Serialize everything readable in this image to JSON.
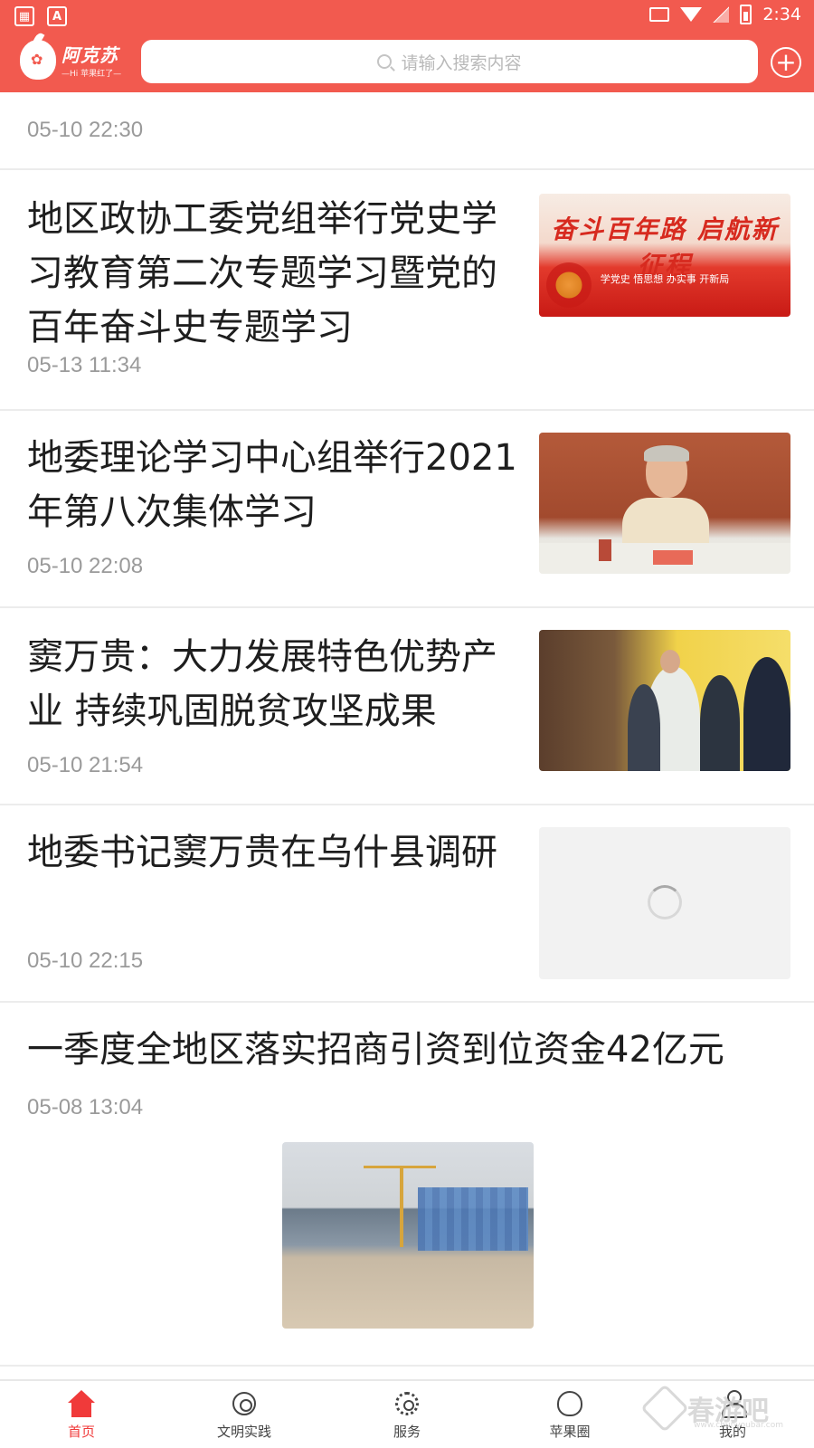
{
  "status_bar": {
    "time": "2:34",
    "notif_icons": [
      "image-icon",
      "a-icon"
    ]
  },
  "header": {
    "logo_name": "阿克苏",
    "logo_slogan": "—Hi 苹果红了—",
    "search_placeholder": "请输入搜索内容",
    "add_icon": "plus-circle-icon",
    "accent_color": "#f25a4f"
  },
  "feed": {
    "top_item_time": "05-10 22:30",
    "items": [
      {
        "title": "地区政协工委党组举行党史学习教育第二次专题学习暨党的百年奋斗史专题学习",
        "time": "05-13 11:34",
        "thumb_banner": "奋斗百年路 启航新征程",
        "thumb_sub": "学党史 悟思想 办实事 开新局"
      },
      {
        "title": "地委理论学习中心组举行2021年第八次集体学习",
        "time": "05-10 22:08"
      },
      {
        "title": "窦万贵：大力发展特色优势产业 持续巩固脱贫攻坚成果",
        "time": "05-10 21:54"
      },
      {
        "title": "地委书记窦万贵在乌什县调研",
        "time": "05-10 22:15"
      },
      {
        "title": "一季度全地区落实招商引资到位资金42亿元",
        "time": "05-08 13:04"
      }
    ]
  },
  "bottom_nav": {
    "items": [
      {
        "label": "首页",
        "icon": "home-icon",
        "active": true
      },
      {
        "label": "文明实践",
        "icon": "medal-icon",
        "active": false
      },
      {
        "label": "服务",
        "icon": "gear-icon",
        "active": false
      },
      {
        "label": "苹果圈",
        "icon": "apple-icon",
        "active": false
      },
      {
        "label": "我的",
        "icon": "user-icon",
        "active": false
      }
    ],
    "active_color": "#f03a3a"
  },
  "watermark": {
    "text": "春游吧",
    "url": "www.chunyoubar.com"
  }
}
